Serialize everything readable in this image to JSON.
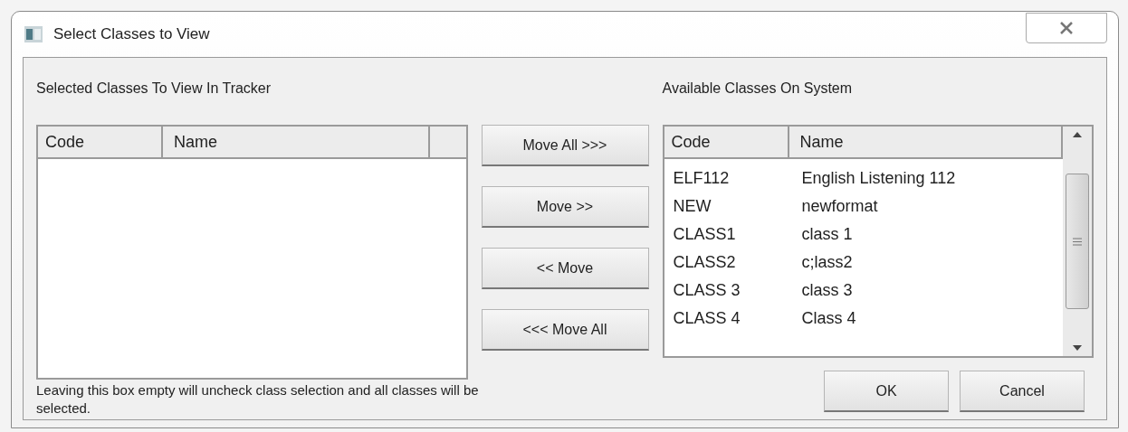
{
  "window": {
    "title": "Select Classes to View"
  },
  "selected_list": {
    "label": "Selected Classes To View In Tracker",
    "columns": [
      "Code",
      "Name"
    ]
  },
  "move_buttons": [
    "Move All >>>",
    "Move >>",
    "<< Move",
    "<<< Move All"
  ],
  "available_list": {
    "label": "Available Classes On System",
    "columns": [
      "Code",
      "Name"
    ],
    "rows": [
      {
        "code": "ELF112",
        "name": "English Listening 112"
      },
      {
        "code": "NEW",
        "name": "newformat"
      },
      {
        "code": "CLASS1",
        "name": "class 1"
      },
      {
        "code": "CLASS2",
        "name": "c;lass2"
      },
      {
        "code": "CLASS 3",
        "name": "class 3"
      },
      {
        "code": "CLASS 4",
        "name": "Class 4"
      }
    ]
  },
  "note": "Leaving this box empty will uncheck class selection and all classes will be selected.",
  "buttons": [
    "OK",
    "Cancel"
  ]
}
